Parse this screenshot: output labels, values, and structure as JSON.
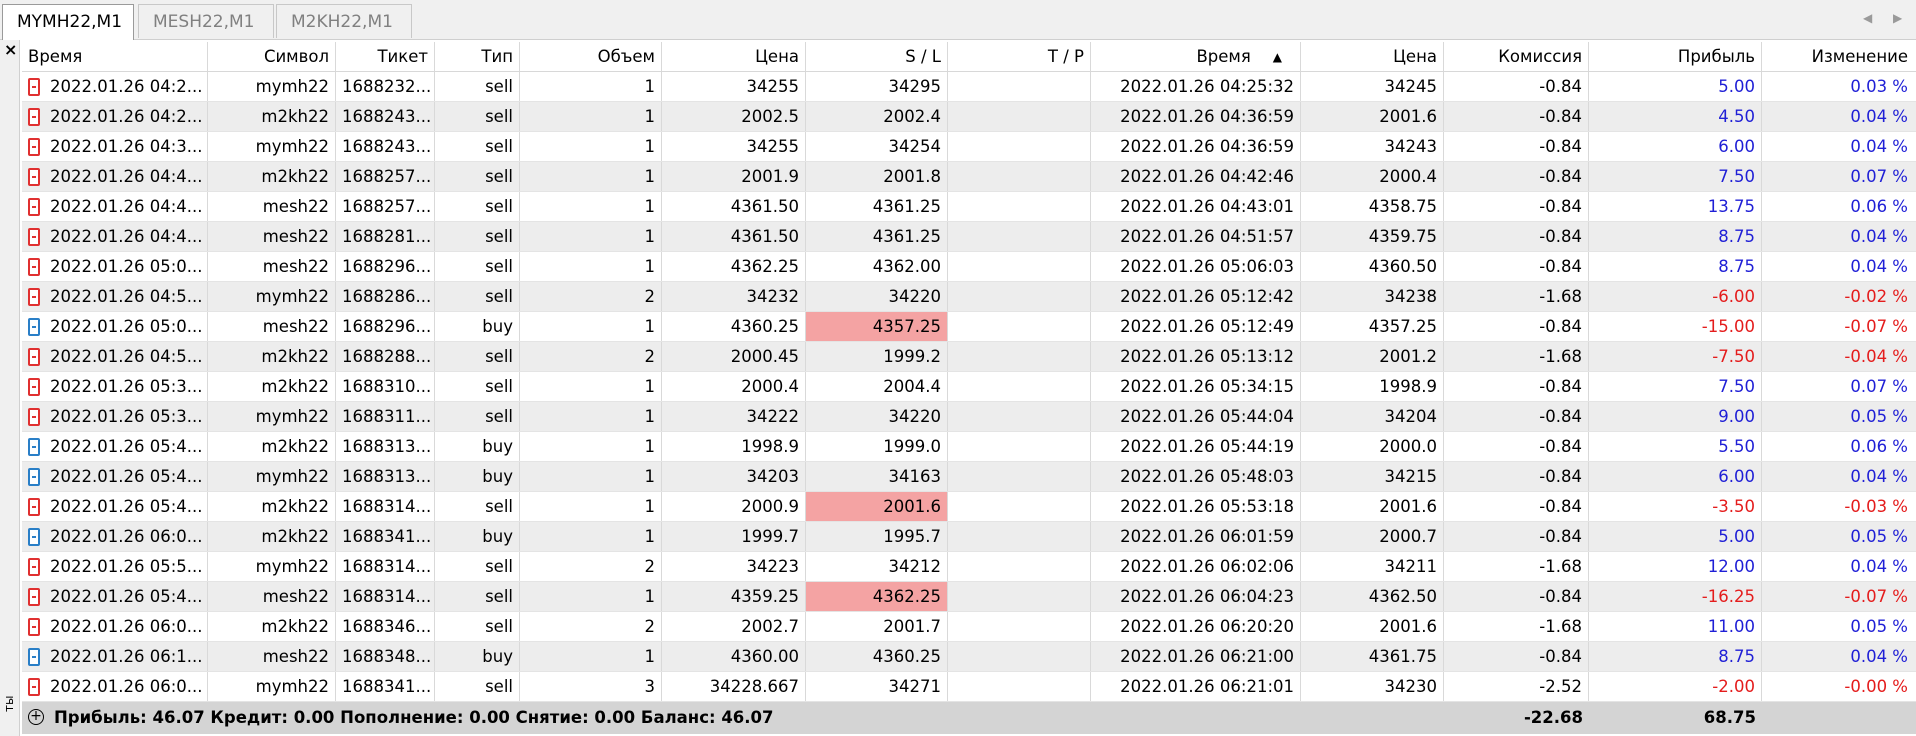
{
  "tabs": [
    {
      "label": "MYMH22,M1",
      "active": true
    },
    {
      "label": "MESH22,M1",
      "active": false
    },
    {
      "label": "M2KH22,M1",
      "active": false
    }
  ],
  "left_strip": {
    "close_glyph": "×",
    "vertical_label": "ты"
  },
  "columns": [
    "Время",
    "Символ",
    "Тикет",
    "Тип",
    "Объем",
    "Цена",
    "S / L",
    "T / P",
    "Время",
    "Цена",
    "Комиссия",
    "Прибыль",
    "Изменение"
  ],
  "rows": [
    {
      "open_time": "2022.01.26 04:2...",
      "symbol": "mymh22",
      "ticket": "1688232...",
      "type": "sell",
      "volume": "1",
      "price": "34255",
      "sl": "34295",
      "tp": "",
      "close_time": "2022.01.26 04:25:32",
      "close_price": "34245",
      "commission": "-0.84",
      "profit": "5.00",
      "change": "0.03 %",
      "sl_hit": false,
      "positive": true
    },
    {
      "open_time": "2022.01.26 04:2...",
      "symbol": "m2kh22",
      "ticket": "1688243...",
      "type": "sell",
      "volume": "1",
      "price": "2002.5",
      "sl": "2002.4",
      "tp": "",
      "close_time": "2022.01.26 04:36:59",
      "close_price": "2001.6",
      "commission": "-0.84",
      "profit": "4.50",
      "change": "0.04 %",
      "sl_hit": false,
      "positive": true
    },
    {
      "open_time": "2022.01.26 04:3...",
      "symbol": "mymh22",
      "ticket": "1688243...",
      "type": "sell",
      "volume": "1",
      "price": "34255",
      "sl": "34254",
      "tp": "",
      "close_time": "2022.01.26 04:36:59",
      "close_price": "34243",
      "commission": "-0.84",
      "profit": "6.00",
      "change": "0.04 %",
      "sl_hit": false,
      "positive": true
    },
    {
      "open_time": "2022.01.26 04:4...",
      "symbol": "m2kh22",
      "ticket": "1688257...",
      "type": "sell",
      "volume": "1",
      "price": "2001.9",
      "sl": "2001.8",
      "tp": "",
      "close_time": "2022.01.26 04:42:46",
      "close_price": "2000.4",
      "commission": "-0.84",
      "profit": "7.50",
      "change": "0.07 %",
      "sl_hit": false,
      "positive": true
    },
    {
      "open_time": "2022.01.26 04:4...",
      "symbol": "mesh22",
      "ticket": "1688257...",
      "type": "sell",
      "volume": "1",
      "price": "4361.50",
      "sl": "4361.25",
      "tp": "",
      "close_time": "2022.01.26 04:43:01",
      "close_price": "4358.75",
      "commission": "-0.84",
      "profit": "13.75",
      "change": "0.06 %",
      "sl_hit": false,
      "positive": true
    },
    {
      "open_time": "2022.01.26 04:4...",
      "symbol": "mesh22",
      "ticket": "1688281...",
      "type": "sell",
      "volume": "1",
      "price": "4361.50",
      "sl": "4361.25",
      "tp": "",
      "close_time": "2022.01.26 04:51:57",
      "close_price": "4359.75",
      "commission": "-0.84",
      "profit": "8.75",
      "change": "0.04 %",
      "sl_hit": false,
      "positive": true
    },
    {
      "open_time": "2022.01.26 05:0...",
      "symbol": "mesh22",
      "ticket": "1688296...",
      "type": "sell",
      "volume": "1",
      "price": "4362.25",
      "sl": "4362.00",
      "tp": "",
      "close_time": "2022.01.26 05:06:03",
      "close_price": "4360.50",
      "commission": "-0.84",
      "profit": "8.75",
      "change": "0.04 %",
      "sl_hit": false,
      "positive": true
    },
    {
      "open_time": "2022.01.26 04:5...",
      "symbol": "mymh22",
      "ticket": "1688286...",
      "type": "sell",
      "volume": "2",
      "price": "34232",
      "sl": "34220",
      "tp": "",
      "close_time": "2022.01.26 05:12:42",
      "close_price": "34238",
      "commission": "-1.68",
      "profit": "-6.00",
      "change": "-0.02 %",
      "sl_hit": false,
      "positive": false
    },
    {
      "open_time": "2022.01.26 05:0...",
      "symbol": "mesh22",
      "ticket": "1688296...",
      "type": "buy",
      "volume": "1",
      "price": "4360.25",
      "sl": "4357.25",
      "tp": "",
      "close_time": "2022.01.26 05:12:49",
      "close_price": "4357.25",
      "commission": "-0.84",
      "profit": "-15.00",
      "change": "-0.07 %",
      "sl_hit": true,
      "positive": false
    },
    {
      "open_time": "2022.01.26 04:5...",
      "symbol": "m2kh22",
      "ticket": "1688288...",
      "type": "sell",
      "volume": "2",
      "price": "2000.45",
      "sl": "1999.2",
      "tp": "",
      "close_time": "2022.01.26 05:13:12",
      "close_price": "2001.2",
      "commission": "-1.68",
      "profit": "-7.50",
      "change": "-0.04 %",
      "sl_hit": false,
      "positive": false
    },
    {
      "open_time": "2022.01.26 05:3...",
      "symbol": "m2kh22",
      "ticket": "1688310...",
      "type": "sell",
      "volume": "1",
      "price": "2000.4",
      "sl": "2004.4",
      "tp": "",
      "close_time": "2022.01.26 05:34:15",
      "close_price": "1998.9",
      "commission": "-0.84",
      "profit": "7.50",
      "change": "0.07 %",
      "sl_hit": false,
      "positive": true
    },
    {
      "open_time": "2022.01.26 05:3...",
      "symbol": "mymh22",
      "ticket": "1688311...",
      "type": "sell",
      "volume": "1",
      "price": "34222",
      "sl": "34220",
      "tp": "",
      "close_time": "2022.01.26 05:44:04",
      "close_price": "34204",
      "commission": "-0.84",
      "profit": "9.00",
      "change": "0.05 %",
      "sl_hit": false,
      "positive": true
    },
    {
      "open_time": "2022.01.26 05:4...",
      "symbol": "m2kh22",
      "ticket": "1688313...",
      "type": "buy",
      "volume": "1",
      "price": "1998.9",
      "sl": "1999.0",
      "tp": "",
      "close_time": "2022.01.26 05:44:19",
      "close_price": "2000.0",
      "commission": "-0.84",
      "profit": "5.50",
      "change": "0.06 %",
      "sl_hit": false,
      "positive": true
    },
    {
      "open_time": "2022.01.26 05:4...",
      "symbol": "mymh22",
      "ticket": "1688313...",
      "type": "buy",
      "volume": "1",
      "price": "34203",
      "sl": "34163",
      "tp": "",
      "close_time": "2022.01.26 05:48:03",
      "close_price": "34215",
      "commission": "-0.84",
      "profit": "6.00",
      "change": "0.04 %",
      "sl_hit": false,
      "positive": true
    },
    {
      "open_time": "2022.01.26 05:4...",
      "symbol": "m2kh22",
      "ticket": "1688314...",
      "type": "sell",
      "volume": "1",
      "price": "2000.9",
      "sl": "2001.6",
      "tp": "",
      "close_time": "2022.01.26 05:53:18",
      "close_price": "2001.6",
      "commission": "-0.84",
      "profit": "-3.50",
      "change": "-0.03 %",
      "sl_hit": true,
      "positive": false
    },
    {
      "open_time": "2022.01.26 06:0...",
      "symbol": "m2kh22",
      "ticket": "1688341...",
      "type": "buy",
      "volume": "1",
      "price": "1999.7",
      "sl": "1995.7",
      "tp": "",
      "close_time": "2022.01.26 06:01:59",
      "close_price": "2000.7",
      "commission": "-0.84",
      "profit": "5.00",
      "change": "0.05 %",
      "sl_hit": false,
      "positive": true
    },
    {
      "open_time": "2022.01.26 05:5...",
      "symbol": "mymh22",
      "ticket": "1688314...",
      "type": "sell",
      "volume": "2",
      "price": "34223",
      "sl": "34212",
      "tp": "",
      "close_time": "2022.01.26 06:02:06",
      "close_price": "34211",
      "commission": "-1.68",
      "profit": "12.00",
      "change": "0.04 %",
      "sl_hit": false,
      "positive": true
    },
    {
      "open_time": "2022.01.26 05:4...",
      "symbol": "mesh22",
      "ticket": "1688314...",
      "type": "sell",
      "volume": "1",
      "price": "4359.25",
      "sl": "4362.25",
      "tp": "",
      "close_time": "2022.01.26 06:04:23",
      "close_price": "4362.50",
      "commission": "-0.84",
      "profit": "-16.25",
      "change": "-0.07 %",
      "sl_hit": true,
      "positive": false
    },
    {
      "open_time": "2022.01.26 06:0...",
      "symbol": "m2kh22",
      "ticket": "1688346...",
      "type": "sell",
      "volume": "2",
      "price": "2002.7",
      "sl": "2001.7",
      "tp": "",
      "close_time": "2022.01.26 06:20:20",
      "close_price": "2001.6",
      "commission": "-1.68",
      "profit": "11.00",
      "change": "0.05 %",
      "sl_hit": false,
      "positive": true
    },
    {
      "open_time": "2022.01.26 06:1...",
      "symbol": "mesh22",
      "ticket": "1688348...",
      "type": "buy",
      "volume": "1",
      "price": "4360.00",
      "sl": "4360.25",
      "tp": "",
      "close_time": "2022.01.26 06:21:00",
      "close_price": "4361.75",
      "commission": "-0.84",
      "profit": "8.75",
      "change": "0.04 %",
      "sl_hit": false,
      "positive": true
    },
    {
      "open_time": "2022.01.26 06:0...",
      "symbol": "mymh22",
      "ticket": "1688341...",
      "type": "sell",
      "volume": "3",
      "price": "34228.667",
      "sl": "34271",
      "tp": "",
      "close_time": "2022.01.26 06:21:01",
      "close_price": "34230",
      "commission": "-2.52",
      "profit": "-2.00",
      "change": "-0.00 %",
      "sl_hit": false,
      "positive": false
    }
  ],
  "footer": {
    "summary": "Прибыль: 46.07  Кредит: 0.00  Пополнение: 0.00  Снятие: 0.00  Баланс: 46.07",
    "total_commission": "-22.68",
    "total_profit": "68.75"
  },
  "colors": {
    "positive": "#1f1fd6",
    "negative": "#e41c1c",
    "sl_highlight": "#f4a3a3",
    "sell_icon": "#e03030",
    "buy_icon": "#2a7fc7"
  }
}
